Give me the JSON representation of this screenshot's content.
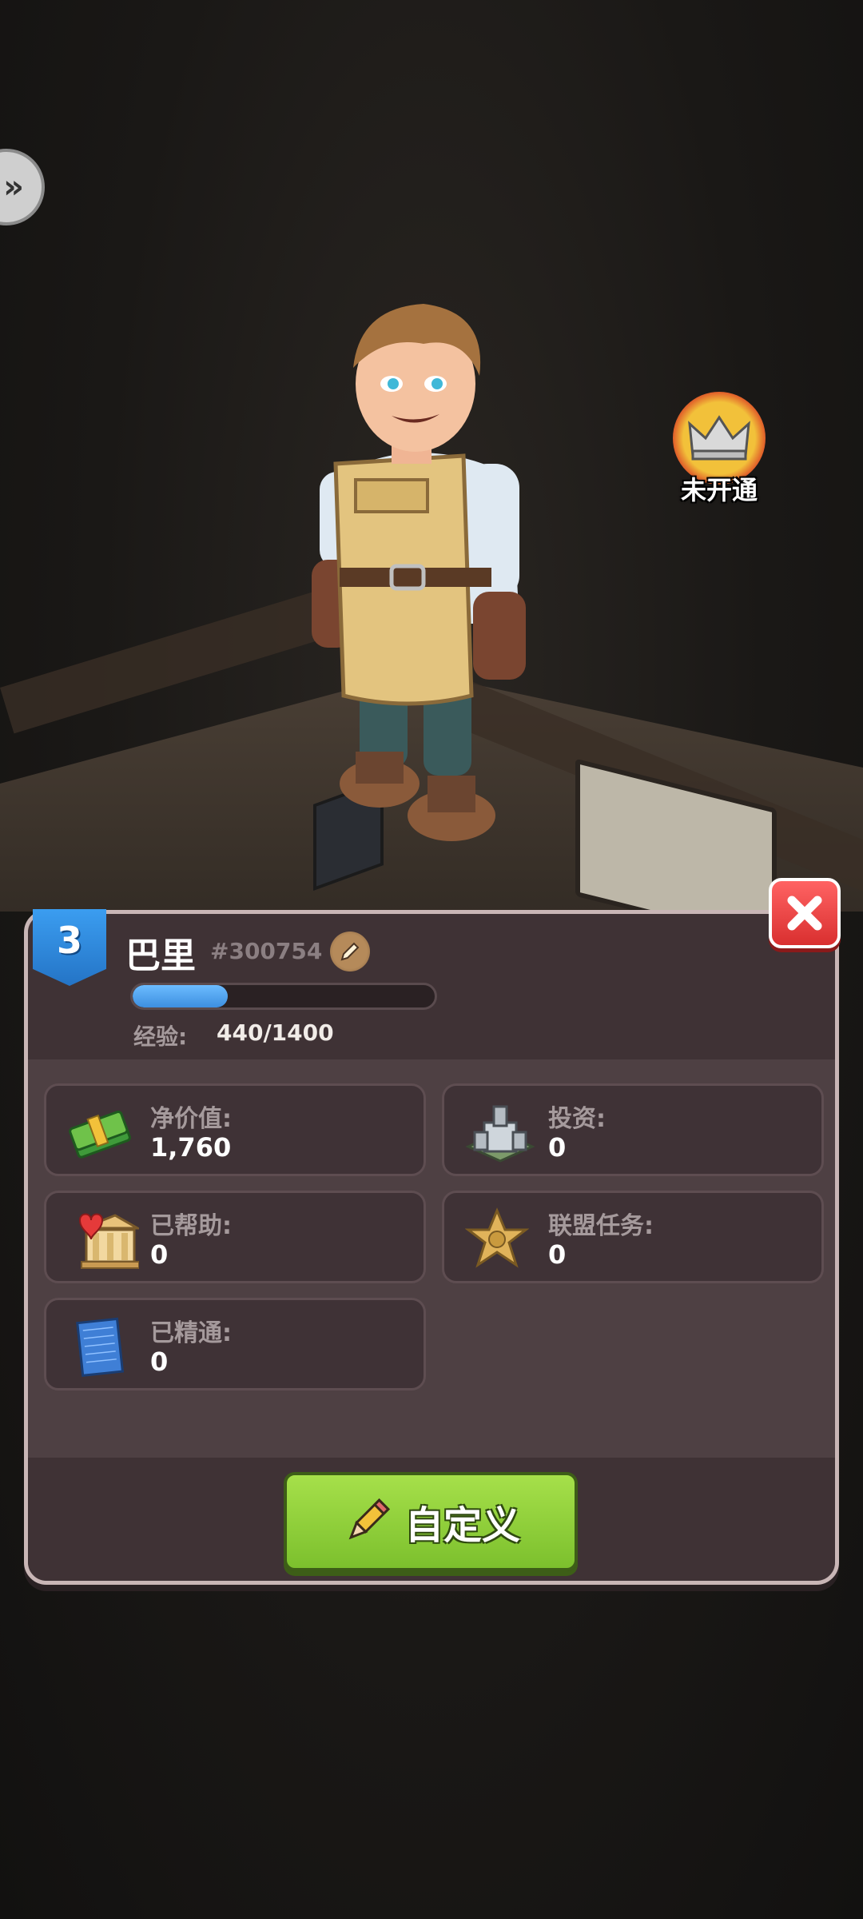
{
  "scene": {
    "crown_label": "未开通"
  },
  "player": {
    "level": "3",
    "name": "巴里",
    "id": "#300754",
    "xp_label": "经验:",
    "xp_value": "440/1400",
    "xp_progress": 0.3143
  },
  "stats": [
    {
      "label": "净价值:",
      "value": "1,760",
      "icon": "cash-stack-icon"
    },
    {
      "label": "投资:",
      "value": "0",
      "icon": "building-icon"
    },
    {
      "label": "已帮助:",
      "value": "0",
      "icon": "charity-building-icon"
    },
    {
      "label": "联盟任务:",
      "value": "0",
      "icon": "sheriff-star-icon"
    },
    {
      "label": "已精通:",
      "value": "0",
      "icon": "blueprint-icon"
    }
  ],
  "footer": {
    "customize_label": "自定义"
  },
  "colors": {
    "panel_bg": "#4e4043",
    "accent_blue": "#3d8fe0",
    "button_green": "#7cc02d",
    "close_red": "#d92f2f"
  }
}
